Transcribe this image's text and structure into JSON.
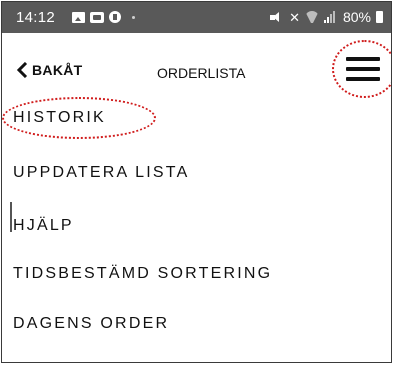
{
  "status_bar": {
    "time": "14:12",
    "left_icons": [
      "gallery-icon",
      "tv-icon",
      "circle-alert-icon"
    ],
    "right_icons": [
      "mute-icon",
      "nfc-icon",
      "wifi-icon",
      "signal-icon"
    ],
    "battery": "80%"
  },
  "header": {
    "back_label": "BAKÅT",
    "title": "ORDERLISTA",
    "menu_icon": "hamburger-menu-icon"
  },
  "menu": {
    "items": [
      {
        "label": "HISTORIK"
      },
      {
        "label": "UPPDATERA LISTA"
      },
      {
        "label": "HJÄLP"
      },
      {
        "label": "TIDSBESTÄMD SORTERING"
      },
      {
        "label": "DAGENS ORDER"
      }
    ]
  },
  "annotation_color": "#d01c1c"
}
